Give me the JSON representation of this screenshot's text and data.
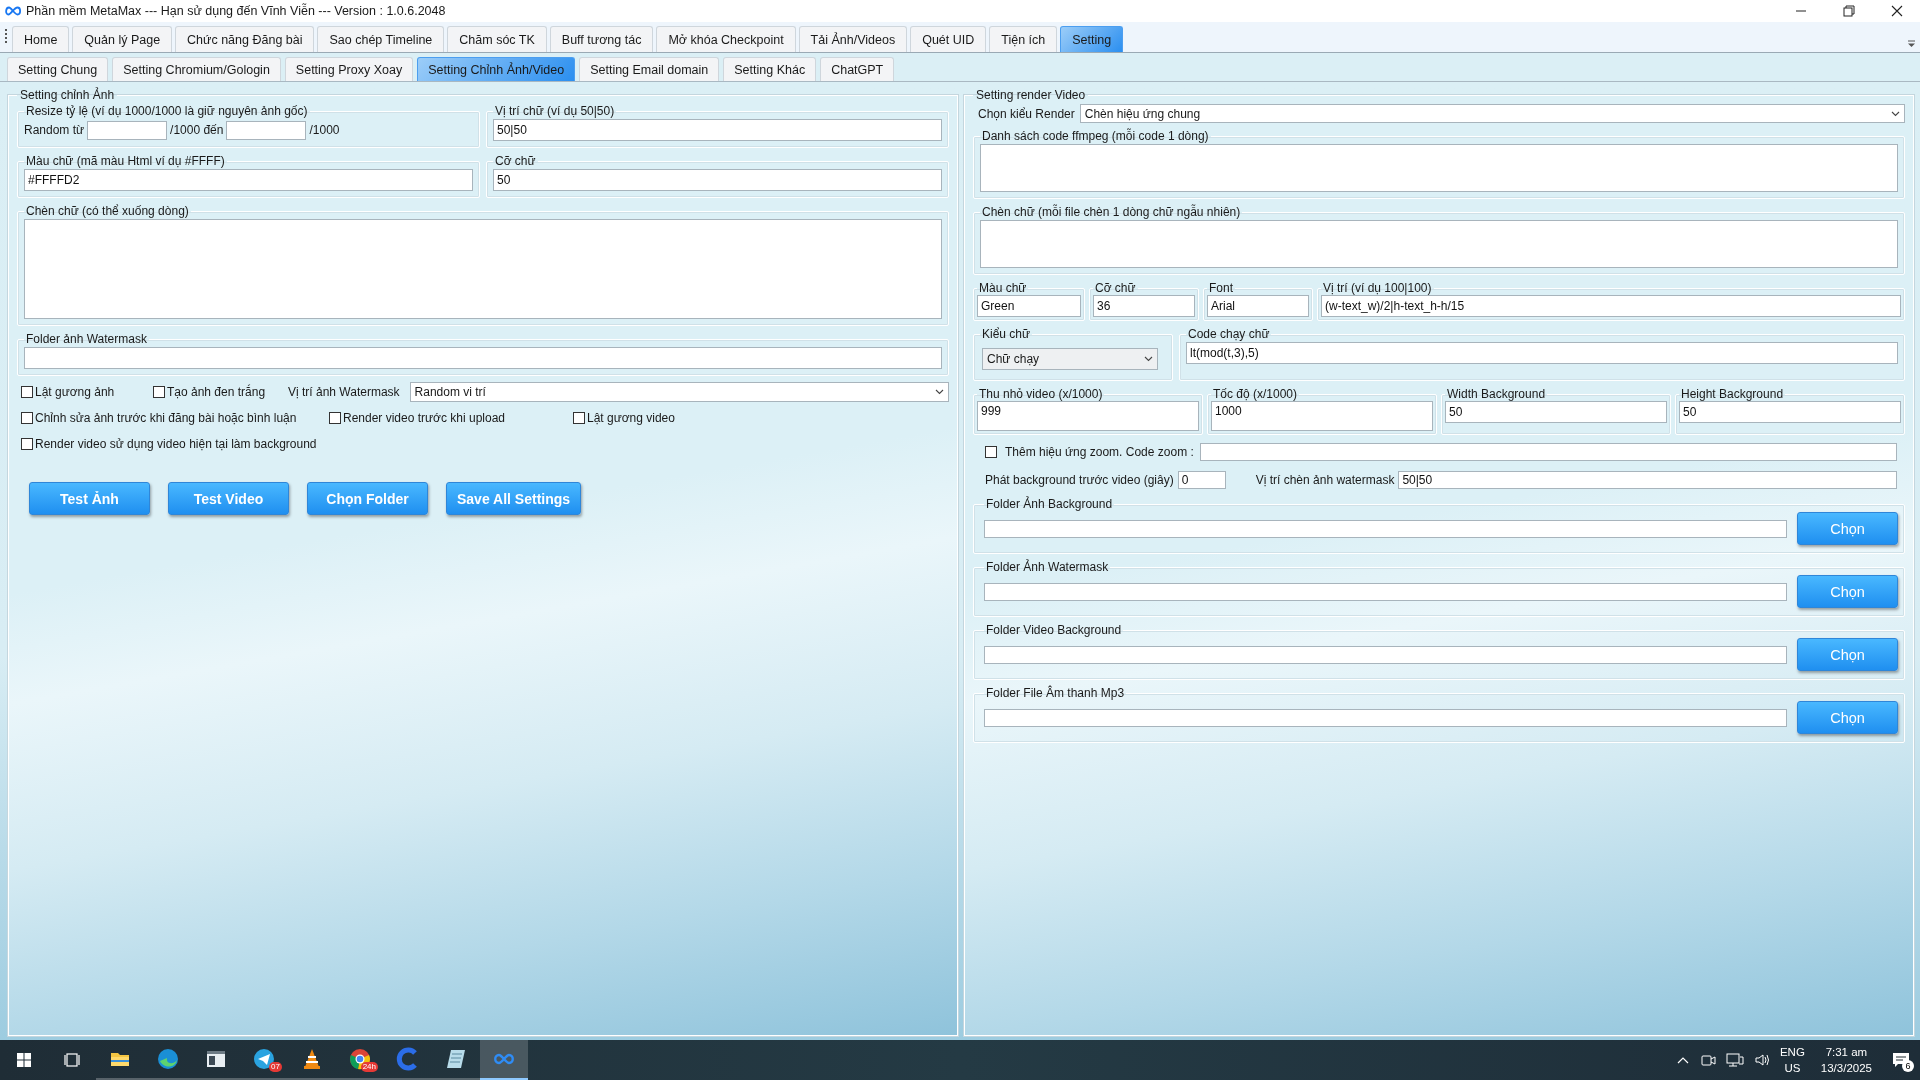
{
  "window": {
    "title": "Phần mềm MetaMax --- Hạn sử dụng đến Vĩnh Viễn --- Version : 1.0.6.2048"
  },
  "main_tabs": [
    {
      "label": "Home",
      "selected": false
    },
    {
      "label": "Quản lý Page",
      "selected": false
    },
    {
      "label": "Chức năng Đăng bài",
      "selected": false
    },
    {
      "label": "Sao chép Timeline",
      "selected": false
    },
    {
      "label": "Chăm sóc TK",
      "selected": false
    },
    {
      "label": "Buff tương tác",
      "selected": false
    },
    {
      "label": "Mở khóa Checkpoint",
      "selected": false
    },
    {
      "label": "Tải Ảnh/Videos",
      "selected": false
    },
    {
      "label": "Quét UID",
      "selected": false
    },
    {
      "label": "Tiện ích",
      "selected": false
    },
    {
      "label": "Setting",
      "selected": true
    }
  ],
  "sub_tabs": [
    {
      "label": "Setting Chung",
      "selected": false
    },
    {
      "label": "Setting Chromium/Gologin",
      "selected": false
    },
    {
      "label": "Setting Proxy Xoay",
      "selected": false
    },
    {
      "label": "Setting Chỉnh Ảnh/Video",
      "selected": true
    },
    {
      "label": "Setting Email domain",
      "selected": false
    },
    {
      "label": "Setting Khác",
      "selected": false
    },
    {
      "label": "ChatGPT",
      "selected": false
    }
  ],
  "image_panel": {
    "title": "Setting chỉnh Ảnh",
    "resize": {
      "label": "Resize tỷ lệ (ví dụ 1000/1000 là giữ nguyên ảnh gốc)",
      "prefix": "Random từ",
      "middle": "/1000 đến",
      "suffix": "/1000"
    },
    "text_position": {
      "label": "Vị trí chữ (ví dụ 50|50)",
      "value": "50|50"
    },
    "text_color": {
      "label": "Màu chữ (mã màu Html ví dụ #FFFF)",
      "value": "#FFFFD2"
    },
    "font_size": {
      "label": "Cỡ chữ",
      "value": "50"
    },
    "insert_text": {
      "label": "Chèn chữ (có thể xuống dòng)"
    },
    "watermark_folder": {
      "label": "Folder ảnh Watermask"
    },
    "checkboxes_row1": [
      {
        "label": "Lật gương ảnh",
        "checked": false
      },
      {
        "label": "Tạo ảnh đen trắng",
        "checked": false
      }
    ],
    "watermark_position": {
      "label": "Vị trí ảnh Watermask",
      "value": "Random vi trí"
    },
    "checkboxes_row2": [
      {
        "label": "Chỉnh sửa ảnh trước khi đăng bài hoặc bình luận",
        "checked": false
      },
      {
        "label": "Render video trước khi upload",
        "checked": false
      },
      {
        "label": "Lật gương video",
        "checked": false
      }
    ],
    "checkboxes_row3": [
      {
        "label": "Render video sử dụng video hiện tại làm background",
        "checked": false
      }
    ],
    "buttons": [
      "Test Ảnh",
      "Test Video",
      "Chọn Folder",
      "Save All Settings"
    ]
  },
  "video_panel": {
    "title": "Setting render Video",
    "render_type": {
      "label": "Chọn kiểu Render",
      "value": "Chèn hiệu ứng chung"
    },
    "ffmpeg_codes": {
      "label": "Danh sách code ffmpeg (mỗi code 1 dòng)"
    },
    "insert_text": {
      "label": "Chèn chữ (mỗi file chèn 1 dòng chữ ngẫu nhiên)"
    },
    "text_fields": [
      {
        "label": "Màu chữ",
        "value": "Green"
      },
      {
        "label": "Cỡ chữ",
        "value": "36"
      },
      {
        "label": "Font",
        "value": "Arial"
      },
      {
        "label": "Vị trí (ví dụ 100|100)",
        "value": "(w-text_w)/2|h-text_h-h/15"
      }
    ],
    "text_style": {
      "label": "Kiểu chữ",
      "value": "Chữ chạy"
    },
    "scroll_code": {
      "label": "Code chạy chữ",
      "value": "lt(mod(t,3),5)"
    },
    "size_fields": [
      {
        "label": "Thu nhỏ video (x/1000)",
        "value": "999"
      },
      {
        "label": "Tốc độ (x/1000)",
        "value": "1000"
      },
      {
        "label": "Width Background",
        "value": "50"
      },
      {
        "label": "Height Background",
        "value": "50"
      }
    ],
    "zoom": {
      "label": "Thêm hiệu ứng zoom. Code zoom :",
      "checked": false
    },
    "background_delay": {
      "label": "Phát background trước video (giây)",
      "value": "0"
    },
    "watermark_position": {
      "label": "Vị trí chèn ảnh watermask",
      "value": "50|50"
    },
    "folders": [
      {
        "label": "Folder Ảnh Background",
        "button": "Chọn"
      },
      {
        "label": "Folder Ảnh Watermask",
        "button": "Chọn"
      },
      {
        "label": "Folder Video Background",
        "button": "Chọn"
      },
      {
        "label": "Folder File Âm thanh Mp3",
        "button": "Chọn"
      }
    ]
  },
  "taskbar": {
    "apps": [
      {
        "kind": "explorer",
        "selected": false
      },
      {
        "kind": "edge",
        "selected": false
      },
      {
        "kind": "window",
        "selected": false
      },
      {
        "kind": "telegram",
        "selected": false,
        "badge": "07"
      },
      {
        "kind": "vlc",
        "selected": false
      },
      {
        "kind": "chrome",
        "selected": false,
        "badge": "24h"
      },
      {
        "kind": "coccoc",
        "selected": false
      },
      {
        "kind": "notes",
        "selected": false
      },
      {
        "kind": "metamax",
        "selected": true
      }
    ],
    "language": "ENG",
    "region": "US",
    "time": "7:31 am",
    "date": "13/3/2025",
    "notifications": "6"
  }
}
